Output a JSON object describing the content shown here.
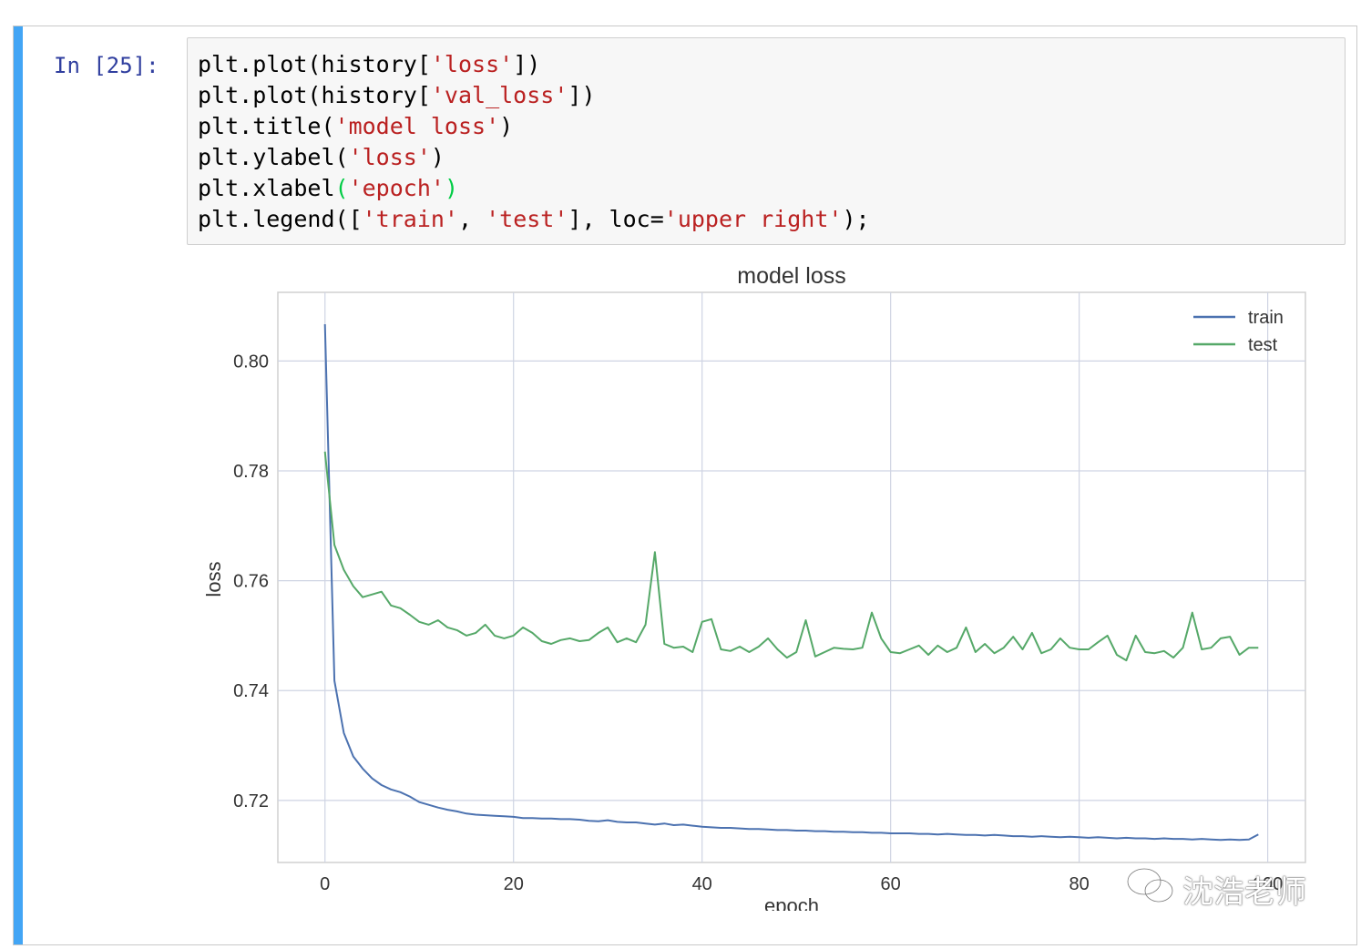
{
  "cell": {
    "prompt": "In [25]:",
    "code_lines": [
      [
        {
          "t": "plt.plot(history[",
          "c": "p"
        },
        {
          "t": "'loss'",
          "c": "s"
        },
        {
          "t": "])",
          "c": "p"
        }
      ],
      [
        {
          "t": "plt.plot(history[",
          "c": "p"
        },
        {
          "t": "'val_loss'",
          "c": "s"
        },
        {
          "t": "])",
          "c": "p"
        }
      ],
      [
        {
          "t": "plt.title(",
          "c": "p"
        },
        {
          "t": "'model loss'",
          "c": "s"
        },
        {
          "t": ")",
          "c": "p"
        }
      ],
      [
        {
          "t": "plt.ylabel(",
          "c": "p"
        },
        {
          "t": "'loss'",
          "c": "s"
        },
        {
          "t": ")",
          "c": "p"
        }
      ],
      [
        {
          "t": "plt.xlabel",
          "c": "p"
        },
        {
          "t": "(",
          "c": "hl"
        },
        {
          "t": "'epoch'",
          "c": "s"
        },
        {
          "t": ")",
          "c": "hl"
        }
      ],
      [
        {
          "t": "plt.legend([",
          "c": "p"
        },
        {
          "t": "'train'",
          "c": "s"
        },
        {
          "t": ", ",
          "c": "p"
        },
        {
          "t": "'test'",
          "c": "s"
        },
        {
          "t": "], loc=",
          "c": "p"
        },
        {
          "t": "'upper right'",
          "c": "s"
        },
        {
          "t": ");",
          "c": "p"
        }
      ]
    ]
  },
  "watermark": {
    "text": "沈浩老师",
    "icon": "wechat-icon"
  },
  "chart_data": {
    "type": "line",
    "title": "model loss",
    "xlabel": "epoch",
    "ylabel": "loss",
    "xlim": [
      -5,
      104
    ],
    "ylim": [
      0.7087,
      0.8125
    ],
    "xticks": [
      0,
      20,
      40,
      60,
      80,
      100
    ],
    "xtick_labels": [
      "0",
      "20",
      "40",
      "60",
      "80",
      "100"
    ],
    "yticks": [
      0.72,
      0.74,
      0.76,
      0.78,
      0.8
    ],
    "ytick_labels": [
      "0.72",
      "0.74",
      "0.76",
      "0.78",
      "0.80"
    ],
    "grid": true,
    "legend": "upper right",
    "series": [
      {
        "name": "train",
        "color": "#4c72b0",
        "x": [
          0,
          1,
          2,
          3,
          4,
          5,
          6,
          7,
          8,
          9,
          10,
          11,
          12,
          13,
          14,
          15,
          16,
          17,
          18,
          19,
          20,
          21,
          22,
          23,
          24,
          25,
          26,
          27,
          28,
          29,
          30,
          31,
          32,
          33,
          34,
          35,
          36,
          37,
          38,
          39,
          40,
          41,
          42,
          43,
          44,
          45,
          46,
          47,
          48,
          49,
          50,
          51,
          52,
          53,
          54,
          55,
          56,
          57,
          58,
          59,
          60,
          61,
          62,
          63,
          64,
          65,
          66,
          67,
          68,
          69,
          70,
          71,
          72,
          73,
          74,
          75,
          76,
          77,
          78,
          79,
          80,
          81,
          82,
          83,
          84,
          85,
          86,
          87,
          88,
          89,
          90,
          91,
          92,
          93,
          94,
          95,
          96,
          97,
          98,
          99
        ],
        "values": [
          0.8067,
          0.7418,
          0.7323,
          0.728,
          0.7258,
          0.724,
          0.7228,
          0.722,
          0.7215,
          0.7207,
          0.7197,
          0.7192,
          0.7187,
          0.7183,
          0.718,
          0.7176,
          0.7174,
          0.7173,
          0.7172,
          0.7171,
          0.717,
          0.7168,
          0.7168,
          0.7167,
          0.7167,
          0.7166,
          0.7166,
          0.7165,
          0.7163,
          0.7162,
          0.7164,
          0.7161,
          0.716,
          0.716,
          0.7158,
          0.7156,
          0.7158,
          0.7155,
          0.7156,
          0.7154,
          0.7152,
          0.7151,
          0.715,
          0.715,
          0.7149,
          0.7148,
          0.7148,
          0.7147,
          0.7146,
          0.7146,
          0.7145,
          0.7145,
          0.7144,
          0.7144,
          0.7143,
          0.7143,
          0.7142,
          0.7142,
          0.7141,
          0.7141,
          0.714,
          0.714,
          0.714,
          0.7139,
          0.7139,
          0.7138,
          0.7139,
          0.7138,
          0.7137,
          0.7137,
          0.7136,
          0.7137,
          0.7136,
          0.7135,
          0.7135,
          0.7134,
          0.7135,
          0.7134,
          0.7133,
          0.7134,
          0.7133,
          0.7132,
          0.7133,
          0.7132,
          0.7131,
          0.7132,
          0.7131,
          0.7131,
          0.713,
          0.7131,
          0.713,
          0.713,
          0.7129,
          0.713,
          0.7129,
          0.7128,
          0.7129,
          0.7128,
          0.7129,
          0.7138
        ]
      },
      {
        "name": "test",
        "color": "#55a868",
        "x": [
          0,
          1,
          2,
          3,
          4,
          5,
          6,
          7,
          8,
          9,
          10,
          11,
          12,
          13,
          14,
          15,
          16,
          17,
          18,
          19,
          20,
          21,
          22,
          23,
          24,
          25,
          26,
          27,
          28,
          29,
          30,
          31,
          32,
          33,
          34,
          35,
          36,
          37,
          38,
          39,
          40,
          41,
          42,
          43,
          44,
          45,
          46,
          47,
          48,
          49,
          50,
          51,
          52,
          53,
          54,
          55,
          56,
          57,
          58,
          59,
          60,
          61,
          62,
          63,
          64,
          65,
          66,
          67,
          68,
          69,
          70,
          71,
          72,
          73,
          74,
          75,
          76,
          77,
          78,
          79,
          80,
          81,
          82,
          83,
          84,
          85,
          86,
          87,
          88,
          89,
          90,
          91,
          92,
          93,
          94,
          95,
          96,
          97,
          98,
          99
        ],
        "values": [
          0.7835,
          0.7665,
          0.762,
          0.759,
          0.757,
          0.7575,
          0.758,
          0.7555,
          0.755,
          0.7538,
          0.7525,
          0.752,
          0.7528,
          0.7515,
          0.751,
          0.75,
          0.7505,
          0.752,
          0.75,
          0.7495,
          0.75,
          0.7515,
          0.7505,
          0.749,
          0.7485,
          0.7492,
          0.7495,
          0.749,
          0.7492,
          0.7505,
          0.7515,
          0.7488,
          0.7495,
          0.7488,
          0.752,
          0.7652,
          0.7485,
          0.7478,
          0.748,
          0.747,
          0.7525,
          0.753,
          0.7475,
          0.7472,
          0.748,
          0.747,
          0.748,
          0.7495,
          0.7475,
          0.746,
          0.747,
          0.7528,
          0.7462,
          0.747,
          0.7478,
          0.7476,
          0.7475,
          0.7478,
          0.7542,
          0.7495,
          0.747,
          0.7468,
          0.7475,
          0.7482,
          0.7465,
          0.7482,
          0.747,
          0.7478,
          0.7515,
          0.747,
          0.7485,
          0.7468,
          0.7478,
          0.7498,
          0.7475,
          0.7505,
          0.7468,
          0.7475,
          0.7495,
          0.7478,
          0.7475,
          0.7475,
          0.7488,
          0.75,
          0.7465,
          0.7455,
          0.75,
          0.747,
          0.7468,
          0.7472,
          0.746,
          0.7478,
          0.7542,
          0.7475,
          0.7478,
          0.7495,
          0.7498,
          0.7465,
          0.7478,
          0.7478
        ]
      }
    ]
  }
}
